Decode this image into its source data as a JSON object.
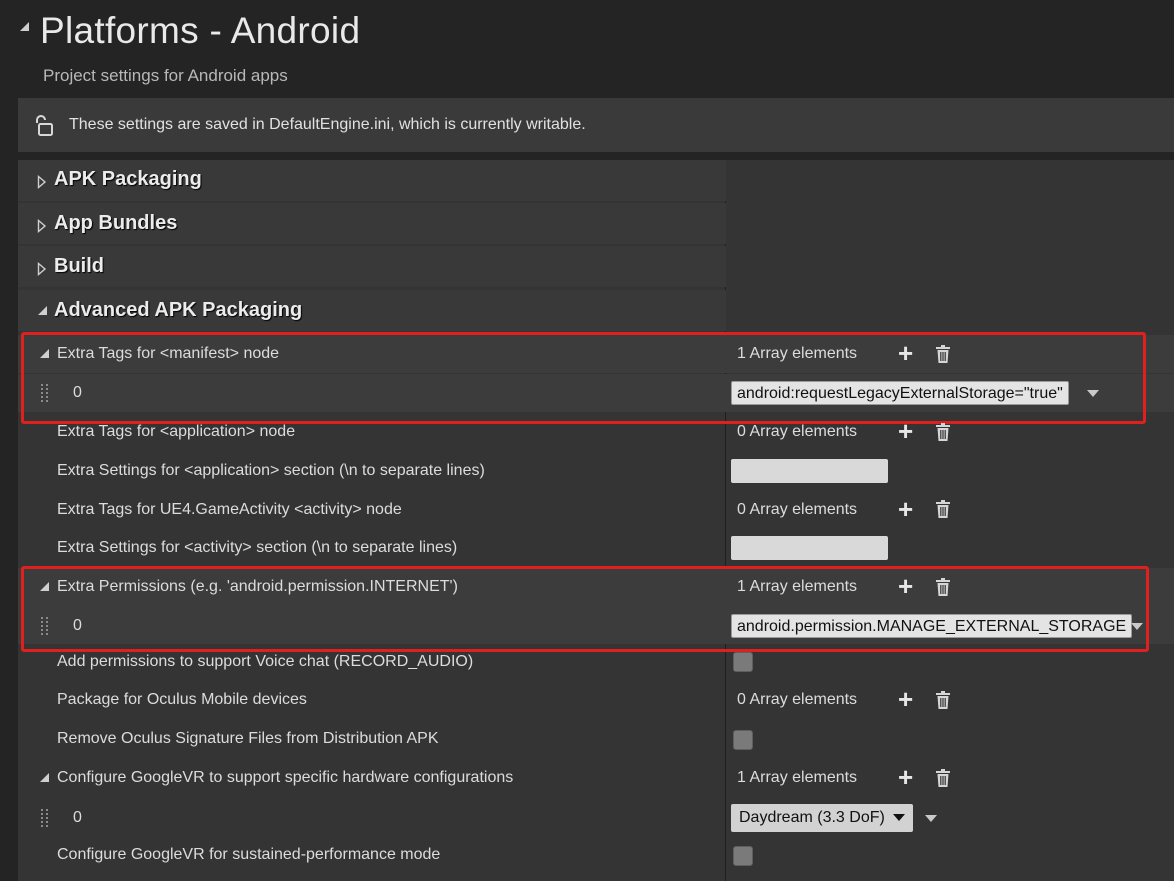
{
  "header": {
    "title": "Platforms - Android",
    "subtitle": "Project settings for Android apps"
  },
  "notice": {
    "text": "These settings are saved in DefaultEngine.ini, which is currently writable.",
    "icon": "unlocked-padlock-icon"
  },
  "categories": [
    {
      "label": "APK Packaging",
      "expanded": false
    },
    {
      "label": "App Bundles",
      "expanded": false
    },
    {
      "label": "Build",
      "expanded": false
    },
    {
      "label": "Advanced APK Packaging",
      "expanded": true
    }
  ],
  "properties": {
    "manifest_tags": {
      "label": "Extra Tags for <manifest> node",
      "count": "1 Array elements",
      "index": "0",
      "value": "android:requestLegacyExternalStorage=\"true\""
    },
    "application_tags": {
      "label": "Extra Tags for <application> node",
      "count": "0 Array elements"
    },
    "application_settings": {
      "label": "Extra Settings for <application> section (\\n to separate lines)",
      "value": ""
    },
    "activity_tags": {
      "label": "Extra Tags for UE4.GameActivity <activity> node",
      "count": "0 Array elements"
    },
    "activity_settings": {
      "label": "Extra Settings for <activity> section (\\n to separate lines)",
      "value": ""
    },
    "permissions": {
      "label": "Extra Permissions (e.g. 'android.permission.INTERNET')",
      "count": "1 Array elements",
      "index": "0",
      "value": "android.permission.MANAGE_EXTERNAL_STORAGE"
    },
    "voice_chat": {
      "label": "Add permissions to support Voice chat (RECORD_AUDIO)",
      "checked": false
    },
    "oculus_package": {
      "label": "Package for Oculus Mobile devices",
      "count": "0 Array elements"
    },
    "oculus_signature": {
      "label": "Remove Oculus Signature Files from Distribution APK",
      "checked": false
    },
    "googlevr_config": {
      "label": "Configure GoogleVR to support specific hardware configurations",
      "count": "1 Array elements",
      "index": "0",
      "value": "Daydream (3.3 DoF)"
    },
    "googlevr_sustained": {
      "label": "Configure GoogleVR for sustained-performance mode",
      "checked": false
    }
  },
  "colors": {
    "background": "#242424",
    "panel": "#343434",
    "highlight_box": "#e0201f"
  }
}
